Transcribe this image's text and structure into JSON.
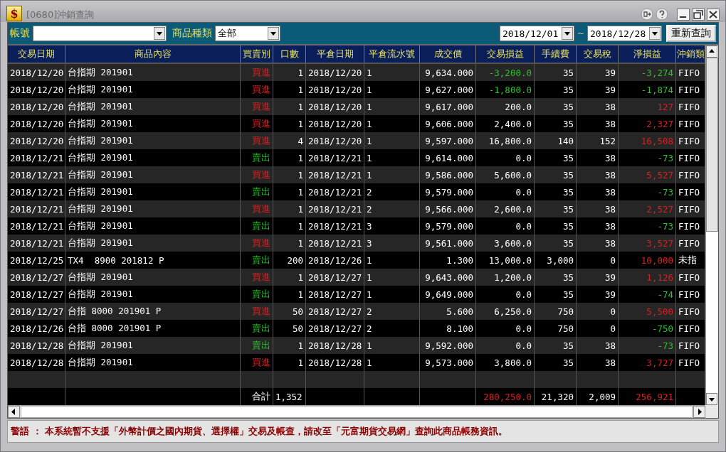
{
  "window": {
    "app_icon": "$",
    "title": "[0680]沖銷查詢"
  },
  "filters": {
    "account_label": "帳號",
    "category_label": "商品種類",
    "category_value": "全部",
    "date_from": "2018/12/01",
    "range_sep": "~",
    "date_to": "2018/12/28",
    "refresh_button": "重新查詢"
  },
  "table": {
    "columns": [
      "交易日期",
      "商品內容",
      "買賣別",
      "口數",
      "平倉日期",
      "平倉流水號",
      "成交價",
      "交易損益",
      "手續費",
      "交易稅",
      "淨損益",
      "沖銷類"
    ],
    "rows": [
      {
        "kind": "buy",
        "pnl_loss": true,
        "net_loss": true,
        "cells": [
          "2018/12/20",
          "台指期 201901",
          "買進",
          "1",
          "2018/12/20",
          "1",
          "9,634.000",
          "-3,200.0",
          "35",
          "39",
          "-3,274",
          "FIFO"
        ]
      },
      {
        "kind": "buy",
        "pnl_loss": true,
        "net_loss": true,
        "cells": [
          "2018/12/20",
          "台指期 201901",
          "買進",
          "1",
          "2018/12/20",
          "1",
          "9,627.000",
          "-1,800.0",
          "35",
          "39",
          "-1,874",
          "FIFO"
        ]
      },
      {
        "kind": "buy",
        "pnl_loss": false,
        "net_loss": false,
        "cells": [
          "2018/12/20",
          "台指期 201901",
          "買進",
          "1",
          "2018/12/20",
          "1",
          "9,617.000",
          "200.0",
          "35",
          "38",
          "127",
          "FIFO"
        ]
      },
      {
        "kind": "buy",
        "pnl_loss": false,
        "net_loss": false,
        "cells": [
          "2018/12/20",
          "台指期 201901",
          "買進",
          "1",
          "2018/12/20",
          "1",
          "9,606.000",
          "2,400.0",
          "35",
          "38",
          "2,327",
          "FIFO"
        ]
      },
      {
        "kind": "buy",
        "pnl_loss": false,
        "net_loss": false,
        "cells": [
          "2018/12/20",
          "台指期 201901",
          "買進",
          "4",
          "2018/12/20",
          "1",
          "9,597.000",
          "16,800.0",
          "140",
          "152",
          "16,508",
          "FIFO"
        ]
      },
      {
        "kind": "sell",
        "pnl_loss": false,
        "net_loss": true,
        "cells": [
          "2018/12/21",
          "台指期 201901",
          "賣出",
          "1",
          "2018/12/21",
          "1",
          "9,614.000",
          "0.0",
          "35",
          "38",
          "-73",
          "FIFO"
        ]
      },
      {
        "kind": "buy",
        "pnl_loss": false,
        "net_loss": false,
        "cells": [
          "2018/12/21",
          "台指期 201901",
          "買進",
          "1",
          "2018/12/21",
          "1",
          "9,586.000",
          "5,600.0",
          "35",
          "38",
          "5,527",
          "FIFO"
        ]
      },
      {
        "kind": "sell",
        "pnl_loss": false,
        "net_loss": true,
        "cells": [
          "2018/12/21",
          "台指期 201901",
          "賣出",
          "1",
          "2018/12/21",
          "2",
          "9,579.000",
          "0.0",
          "35",
          "38",
          "-73",
          "FIFO"
        ]
      },
      {
        "kind": "buy",
        "pnl_loss": false,
        "net_loss": false,
        "cells": [
          "2018/12/21",
          "台指期 201901",
          "買進",
          "1",
          "2018/12/21",
          "2",
          "9,566.000",
          "2,600.0",
          "35",
          "38",
          "2,527",
          "FIFO"
        ]
      },
      {
        "kind": "sell",
        "pnl_loss": false,
        "net_loss": true,
        "cells": [
          "2018/12/21",
          "台指期 201901",
          "賣出",
          "1",
          "2018/12/21",
          "3",
          "9,579.000",
          "0.0",
          "35",
          "38",
          "-73",
          "FIFO"
        ]
      },
      {
        "kind": "buy",
        "pnl_loss": false,
        "net_loss": false,
        "cells": [
          "2018/12/21",
          "台指期 201901",
          "買進",
          "1",
          "2018/12/21",
          "3",
          "9,561.000",
          "3,600.0",
          "35",
          "38",
          "3,527",
          "FIFO"
        ]
      },
      {
        "kind": "sell",
        "pnl_loss": false,
        "net_loss": false,
        "cells": [
          "2018/12/25",
          "TX4  8900 201812 P",
          "賣出",
          "200",
          "2018/12/26",
          "1",
          "1.300",
          "13,000.0",
          "3,000",
          "0",
          "10,000",
          "未指"
        ]
      },
      {
        "kind": "buy",
        "pnl_loss": false,
        "net_loss": false,
        "cells": [
          "2018/12/27",
          "台指期 201901",
          "買進",
          "1",
          "2018/12/27",
          "1",
          "9,643.000",
          "1,200.0",
          "35",
          "39",
          "1,126",
          "FIFO"
        ]
      },
      {
        "kind": "sell",
        "pnl_loss": false,
        "net_loss": true,
        "cells": [
          "2018/12/27",
          "台指期 201901",
          "賣出",
          "1",
          "2018/12/27",
          "1",
          "9,649.000",
          "0.0",
          "35",
          "39",
          "-74",
          "FIFO"
        ]
      },
      {
        "kind": "buy",
        "pnl_loss": false,
        "net_loss": false,
        "cells": [
          "2018/12/27",
          "台指 8000 201901 P",
          "買進",
          "50",
          "2018/12/27",
          "2",
          "5.600",
          "6,250.0",
          "750",
          "0",
          "5,500",
          "FIFO"
        ]
      },
      {
        "kind": "sell",
        "pnl_loss": false,
        "net_loss": true,
        "cells": [
          "2018/12/26",
          "台指 8000 201901 P",
          "賣出",
          "50",
          "2018/12/27",
          "2",
          "8.100",
          "0.0",
          "750",
          "0",
          "-750",
          "FIFO"
        ]
      },
      {
        "kind": "sell",
        "pnl_loss": false,
        "net_loss": true,
        "cells": [
          "2018/12/28",
          "台指期 201901",
          "賣出",
          "1",
          "2018/12/28",
          "1",
          "9,592.000",
          "0.0",
          "35",
          "38",
          "-73",
          "FIFO"
        ]
      },
      {
        "kind": "buy",
        "pnl_loss": false,
        "net_loss": false,
        "cells": [
          "2018/12/28",
          "台指期 201901",
          "買進",
          "1",
          "2018/12/28",
          "1",
          "9,573.000",
          "3,800.0",
          "35",
          "38",
          "3,727",
          "FIFO"
        ]
      }
    ],
    "totals": {
      "label": "合計",
      "quantity": "1,352",
      "trade_pnl": "280,250.0",
      "fee": "21,320",
      "tax": "2,009",
      "net_pnl": "256,921"
    }
  },
  "warning": "警語 ： 本系統暫不支援「外幣計價之國內期貨、選擇權」交易及帳查，請改至「元富期貨交易網」查詢此商品帳務資訊。"
}
